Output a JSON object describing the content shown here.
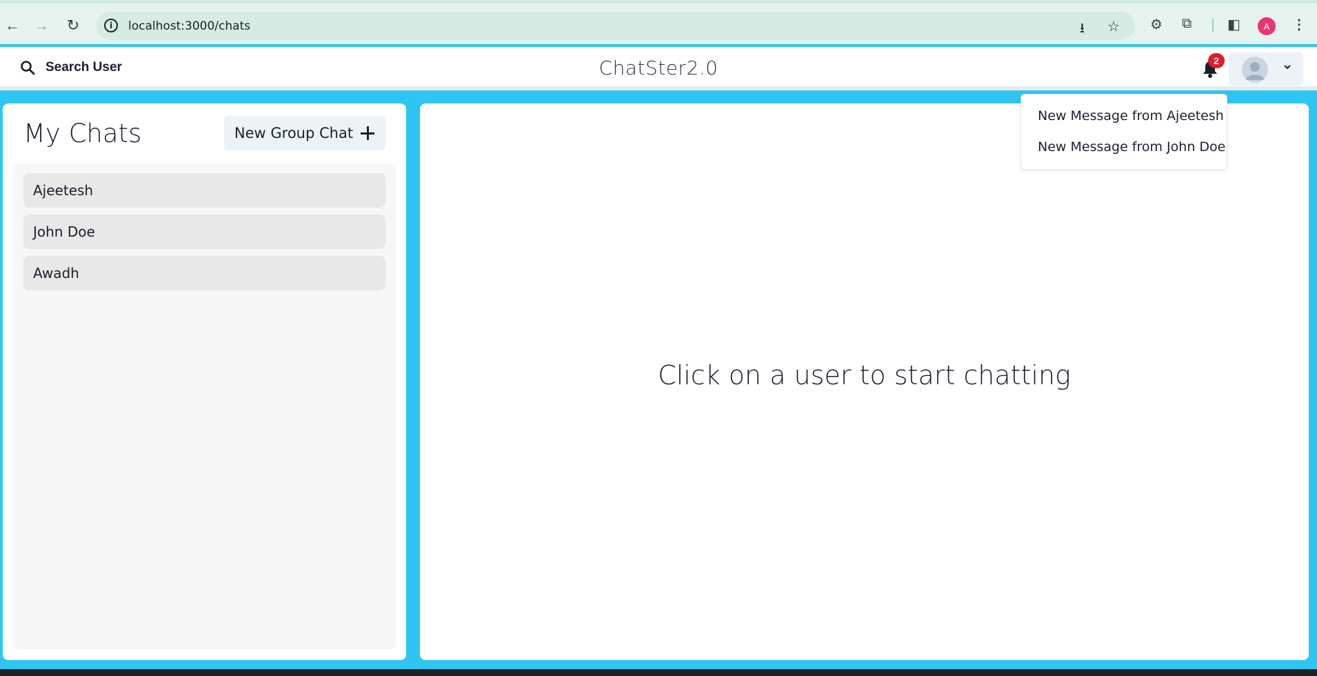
{
  "browser": {
    "url": "localhost:3000/chats",
    "profile_initial": "A"
  },
  "header": {
    "search_label": "Search User",
    "app_title": "ChatSter2.0",
    "notification_count": "2"
  },
  "notifications": [
    "New Message from Ajeetesh",
    "New Message from John Doe"
  ],
  "sidebar": {
    "title": "My Chats",
    "new_group_label": "New Group Chat",
    "chats": [
      "Ajeetesh",
      "John Doe",
      "Awadh"
    ]
  },
  "main": {
    "placeholder": "Click on a user to start chatting"
  },
  "colors": {
    "background": "#2ec5f3",
    "badge": "#e11d2a",
    "profile_avatar": "#e8366f"
  }
}
